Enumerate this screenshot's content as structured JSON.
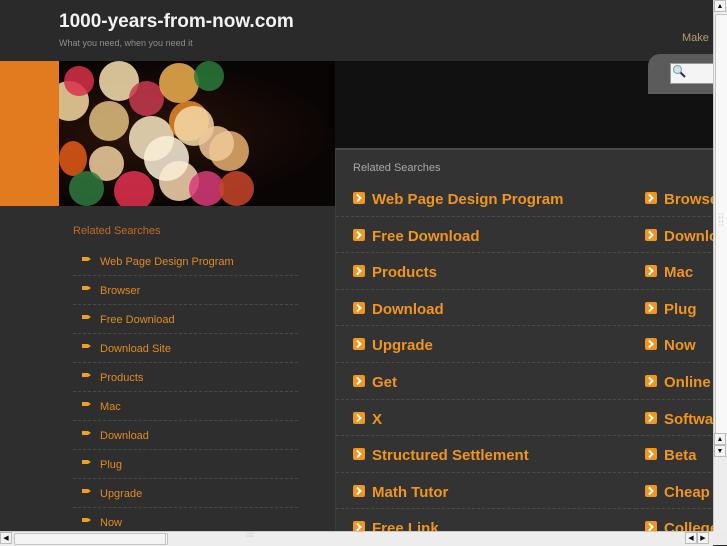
{
  "header": {
    "site_title": "1000-years-from-now.com",
    "tagline": "What you need, when you need it",
    "make_link": "Make"
  },
  "search": {
    "placeholder": "",
    "icon": "search-icon"
  },
  "sidebar": {
    "heading": "Related Searches",
    "bullet_icon": "pointing-hand-icon",
    "items": [
      {
        "label": "Web Page Design Program"
      },
      {
        "label": "Browser"
      },
      {
        "label": "Free Download"
      },
      {
        "label": "Download Site"
      },
      {
        "label": "Products"
      },
      {
        "label": "Mac"
      },
      {
        "label": "Download"
      },
      {
        "label": "Plug"
      },
      {
        "label": "Upgrade"
      },
      {
        "label": "Now"
      }
    ]
  },
  "panel": {
    "heading": "Related Searches",
    "arrow_icon": "chevron-right-icon",
    "column1": [
      {
        "label": "Web Page Design Program"
      },
      {
        "label": "Free Download"
      },
      {
        "label": "Products"
      },
      {
        "label": "Download"
      },
      {
        "label": "Upgrade"
      },
      {
        "label": "Get"
      },
      {
        "label": "X"
      },
      {
        "label": "Structured Settlement"
      },
      {
        "label": "Math Tutor"
      },
      {
        "label": "Free Link"
      }
    ],
    "column2": [
      {
        "label": "Browser"
      },
      {
        "label": "Download"
      },
      {
        "label": "Mac"
      },
      {
        "label": "Plug"
      },
      {
        "label": "Now"
      },
      {
        "label": "Online"
      },
      {
        "label": "Software"
      },
      {
        "label": "Beta"
      },
      {
        "label": "Cheap"
      },
      {
        "label": "College"
      }
    ]
  },
  "scrollbars": {
    "up_arrow": "▲",
    "down_arrow": "▼",
    "left_arrow": "◀",
    "right_arrow": "▶"
  },
  "colors": {
    "accent_orange": "#f0951d",
    "banner_orange": "#e27a1f",
    "background": "#2e2e2e"
  }
}
